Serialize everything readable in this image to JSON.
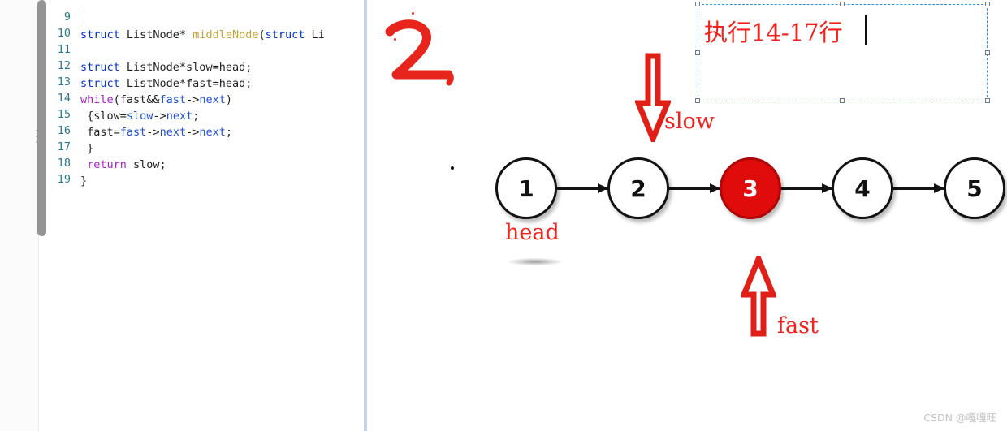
{
  "editor": {
    "scrollbar": {
      "name": "vertical-scrollbar"
    },
    "lines": [
      {
        "num": "9",
        "tokens": []
      },
      {
        "num": "10",
        "tokens": [
          {
            "t": "struct ",
            "c": "kw-type"
          },
          {
            "t": "ListNode* ",
            "c": "plain"
          },
          {
            "t": "middleNode",
            "c": "fn"
          },
          {
            "t": "(",
            "c": "plain"
          },
          {
            "t": "struct ",
            "c": "kw-type"
          },
          {
            "t": "Li",
            "c": "plain"
          }
        ]
      },
      {
        "num": "11",
        "tokens": []
      },
      {
        "num": "12",
        "tokens": [
          {
            "t": "struct ",
            "c": "kw-type"
          },
          {
            "t": "ListNode*slow=head;",
            "c": "plain"
          }
        ]
      },
      {
        "num": "13",
        "tokens": [
          {
            "t": "struct ",
            "c": "kw-type"
          },
          {
            "t": "ListNode*fast=head;",
            "c": "plain"
          }
        ]
      },
      {
        "num": "14",
        "tokens": [
          {
            "t": "while",
            "c": "kw-ctrl"
          },
          {
            "t": "(fast&&",
            "c": "plain"
          },
          {
            "t": "fast",
            "c": "ident-b"
          },
          {
            "t": "->",
            "c": "plain"
          },
          {
            "t": "next",
            "c": "ident-b"
          },
          {
            "t": ")",
            "c": "plain"
          }
        ]
      },
      {
        "num": "15",
        "tokens": [
          {
            "t": " {slow=",
            "c": "plain"
          },
          {
            "t": "slow",
            "c": "ident-b"
          },
          {
            "t": "->",
            "c": "plain"
          },
          {
            "t": "next",
            "c": "ident-b"
          },
          {
            "t": ";",
            "c": "plain"
          }
        ]
      },
      {
        "num": "16",
        "tokens": [
          {
            "t": " fast=",
            "c": "plain"
          },
          {
            "t": "fast",
            "c": "ident-b"
          },
          {
            "t": "->",
            "c": "plain"
          },
          {
            "t": "next",
            "c": "ident-b"
          },
          {
            "t": "->",
            "c": "plain"
          },
          {
            "t": "next",
            "c": "ident-b"
          },
          {
            "t": ";",
            "c": "plain"
          }
        ]
      },
      {
        "num": "17",
        "tokens": [
          {
            "t": " }",
            "c": "plain"
          }
        ]
      },
      {
        "num": "18",
        "tokens": [
          {
            "t": " ",
            "c": "plain"
          },
          {
            "t": "return",
            "c": "kw-ctrl"
          },
          {
            "t": " slow;",
            "c": "plain"
          }
        ]
      },
      {
        "num": "19",
        "tokens": [
          {
            "t": "}",
            "c": "plain"
          }
        ]
      }
    ]
  },
  "board": {
    "handwritten_mark": "2,",
    "textbox": {
      "text": "执行14-17行",
      "selected": true
    },
    "nodes": [
      {
        "value": "1",
        "active": false
      },
      {
        "value": "2",
        "active": false
      },
      {
        "value": "3",
        "active": true
      },
      {
        "value": "4",
        "active": false
      },
      {
        "value": "5",
        "active": false
      }
    ],
    "labels": {
      "head": "head",
      "slow": "slow",
      "fast": "fast"
    }
  },
  "watermark": "CSDN @嘎嘎旺",
  "colors": {
    "annotation_red": "#f2221b",
    "active_node": "#e00b0b",
    "selection_blue": "#2f8fe0",
    "line_number": "#2b7a8c",
    "keyword_purple": "#a626c4",
    "type_blue": "#0033cc",
    "function_gold": "#c2a23a",
    "identifier_blue": "#1f52d0"
  }
}
